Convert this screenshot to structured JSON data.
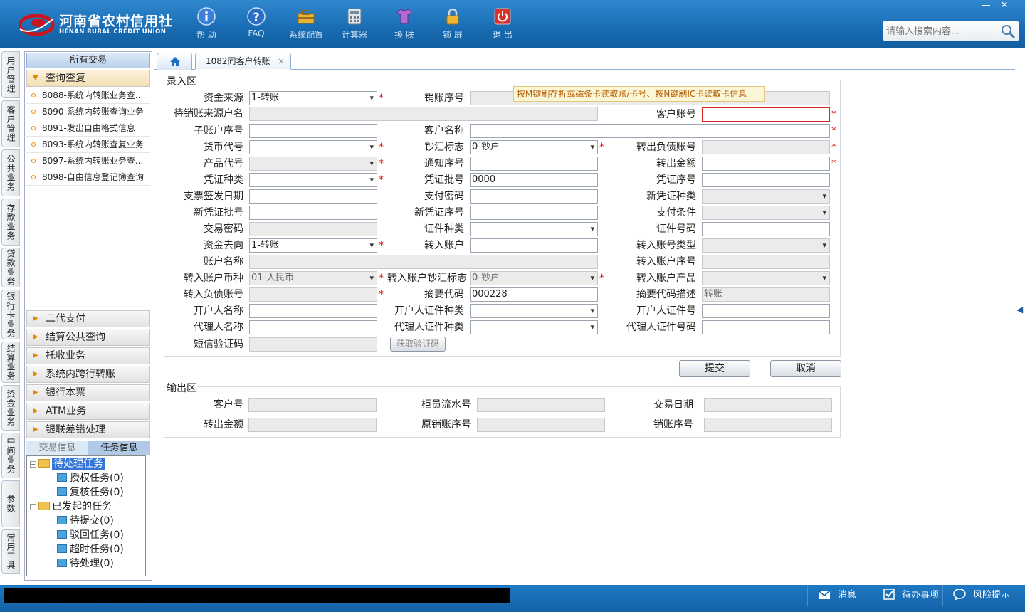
{
  "app": {
    "logo_cn": "河南省农村信用社",
    "logo_en": "HENAN RURAL CREDIT UNION",
    "brand_red": "#c8161e",
    "header_blue": "#1667ad"
  },
  "toolbar": [
    {
      "label": "帮 助",
      "icon": "info-icon"
    },
    {
      "label": "FAQ",
      "icon": "question-icon"
    },
    {
      "label": "系统配置",
      "icon": "toolbox-icon"
    },
    {
      "label": "计算器",
      "icon": "calculator-icon"
    },
    {
      "label": "换 肤",
      "icon": "shirt-icon"
    },
    {
      "label": "锁 屏",
      "icon": "lock-icon"
    },
    {
      "label": "退 出",
      "icon": "power-icon"
    }
  ],
  "window_controls": {
    "minimize": "—",
    "close": "✕"
  },
  "search": {
    "placeholder": "请输入搜索内容..."
  },
  "vertical_tabs": [
    "用户管理",
    "客户管理",
    "公共业务",
    "存款业务",
    "贷款业务",
    "银行卡业务",
    "结算业务",
    "资金业务",
    "中间业务",
    "参数",
    "常用工具"
  ],
  "left_panel": {
    "title": "所有交易",
    "open_group": "查询查复",
    "items": [
      "8088-系统内转账业务查...",
      "8090-系统内转账查询业务",
      "8091-发出自由格式信息",
      "8093-系统内转账查复业务",
      "8097-系统内转账业务查...",
      "8098-自由信息登记簿查询"
    ],
    "groups": [
      "二代支付",
      "结算公共查询",
      "托收业务",
      "系统内跨行转账",
      "银行本票",
      "ATM业务",
      "银联差错处理"
    ],
    "task_tabs": [
      "交易信息",
      "任务信息"
    ],
    "tree": {
      "pending": "待处理任务",
      "authorize": "授权任务(0)",
      "review": "复核任务(0)",
      "initiated": "已发起的任务",
      "to_submit": "待提交(0)",
      "rejected": "驳回任务(0)",
      "timeout": "超时任务(0)",
      "to_handle": "待处理(0)"
    }
  },
  "tabs": {
    "active": "1082同客户转账",
    "close": "×"
  },
  "input_area": {
    "legend": "录入区",
    "tip": "按M键刷存折或磁条卡读取账/卡号、按N键刷IC卡读取卡信息",
    "fields": {
      "fund_source": {
        "label": "资金来源",
        "value": "1-转账"
      },
      "cancel_seq": {
        "label": "销账序号",
        "value": ""
      },
      "pending_src_name": {
        "label": "待销账来源户名",
        "value": ""
      },
      "customer_account": {
        "label": "客户账号",
        "value": ""
      },
      "sub_account_seq": {
        "label": "子账户序号",
        "value": ""
      },
      "customer_name": {
        "label": "客户名称",
        "value": ""
      },
      "currency_code": {
        "label": "货币代号",
        "value": ""
      },
      "cash_flag": {
        "label": "钞汇标志",
        "value": "0-钞户"
      },
      "out_liability_acct": {
        "label": "转出负债账号",
        "value": ""
      },
      "product_code": {
        "label": "产品代号",
        "value": ""
      },
      "notice_seq": {
        "label": "通知序号",
        "value": ""
      },
      "out_amount": {
        "label": "转出金额",
        "value": ""
      },
      "voucher_type": {
        "label": "凭证种类",
        "value": ""
      },
      "voucher_batch": {
        "label": "凭证批号",
        "value": "0000"
      },
      "voucher_seq": {
        "label": "凭证序号",
        "value": ""
      },
      "check_date": {
        "label": "支票签发日期",
        "value": ""
      },
      "pay_password": {
        "label": "支付密码",
        "value": ""
      },
      "new_voucher_type": {
        "label": "新凭证种类",
        "value": ""
      },
      "new_voucher_batch": {
        "label": "新凭证批号",
        "value": ""
      },
      "new_voucher_seq": {
        "label": "新凭证序号",
        "value": ""
      },
      "pay_condition": {
        "label": "支付条件",
        "value": ""
      },
      "tx_password": {
        "label": "交易密码",
        "value": ""
      },
      "id_type": {
        "label": "证件种类",
        "value": ""
      },
      "id_number": {
        "label": "证件号码",
        "value": ""
      },
      "fund_dest": {
        "label": "资金去向",
        "value": "1-转账"
      },
      "in_account": {
        "label": "转入账户",
        "value": ""
      },
      "in_account_type": {
        "label": "转入账号类型",
        "value": ""
      },
      "account_name": {
        "label": "账户名称",
        "value": ""
      },
      "in_account_seq": {
        "label": "转入账户序号",
        "value": ""
      },
      "in_currency": {
        "label": "转入账户币种",
        "value": "01-人民币"
      },
      "in_cash_flag": {
        "label": "转入账户钞汇标志",
        "value": "0-钞户"
      },
      "in_product": {
        "label": "转入账户产品",
        "value": ""
      },
      "in_liability_acct": {
        "label": "转入负债账号",
        "value": ""
      },
      "summary_code": {
        "label": "摘要代码",
        "value": "000228"
      },
      "summary_desc": {
        "label": "摘要代码描述",
        "value": "转账"
      },
      "opener_name": {
        "label": "开户人名称",
        "value": ""
      },
      "opener_id_type": {
        "label": "开户人证件种类",
        "value": ""
      },
      "opener_id_no": {
        "label": "开户人证件号",
        "value": ""
      },
      "agent_name": {
        "label": "代理人名称",
        "value": ""
      },
      "agent_id_type": {
        "label": "代理人证件种类",
        "value": ""
      },
      "agent_id_no": {
        "label": "代理人证件号码",
        "value": ""
      },
      "sms_code": {
        "label": "短信验证码",
        "value": ""
      }
    },
    "get_code_button": "获取验证码",
    "required_mark": "*"
  },
  "actions": {
    "submit": "提交",
    "cancel": "取消"
  },
  "output_area": {
    "legend": "输出区",
    "fields": {
      "customer_no": {
        "label": "客户号",
        "value": ""
      },
      "teller_flow": {
        "label": "柜员流水号",
        "value": ""
      },
      "tx_date": {
        "label": "交易日期",
        "value": ""
      },
      "out_amount": {
        "label": "转出金额",
        "value": ""
      },
      "orig_cancel_seq": {
        "label": "原销账序号",
        "value": ""
      },
      "cancel_seq": {
        "label": "销账序号",
        "value": ""
      }
    }
  },
  "statusbar": {
    "message": "消息",
    "todo": "待办事项",
    "risk": "风险提示"
  }
}
